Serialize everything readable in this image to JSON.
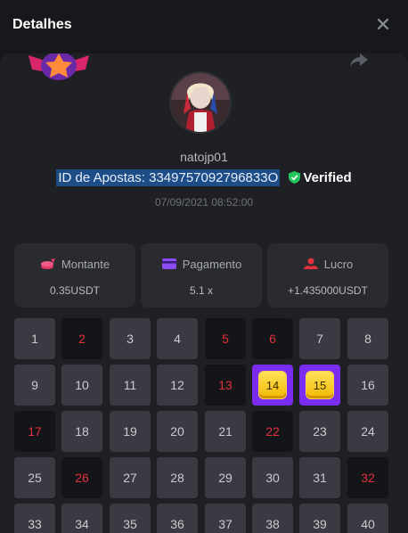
{
  "header": {
    "title": "Detalhes",
    "close_label": "✕"
  },
  "player": {
    "username": "natojp01",
    "bet_id_label": "ID de Apostas: 3349757092796833O",
    "verified_label": "Verified",
    "timestamp": "07/09/2021 08:52:00"
  },
  "stats": [
    {
      "label": "Montante",
      "value": "0.35USDT",
      "icon": "coins-icon",
      "color": "#e23a6a"
    },
    {
      "label": "Pagamento",
      "value": "5.1 x",
      "icon": "card-icon",
      "color": "#8a4bf0"
    },
    {
      "label": "Lucro",
      "value": "+1.435000USDT",
      "icon": "profit-icon",
      "color": "#e0323a"
    }
  ],
  "grid": [
    {
      "n": "1",
      "state": "normal"
    },
    {
      "n": "2",
      "state": "red"
    },
    {
      "n": "3",
      "state": "normal"
    },
    {
      "n": "4",
      "state": "normal"
    },
    {
      "n": "5",
      "state": "red"
    },
    {
      "n": "6",
      "state": "red"
    },
    {
      "n": "7",
      "state": "normal"
    },
    {
      "n": "8",
      "state": "normal"
    },
    {
      "n": "9",
      "state": "normal"
    },
    {
      "n": "10",
      "state": "normal"
    },
    {
      "n": "11",
      "state": "normal"
    },
    {
      "n": "12",
      "state": "normal"
    },
    {
      "n": "13",
      "state": "red"
    },
    {
      "n": "14",
      "state": "hit"
    },
    {
      "n": "15",
      "state": "hit"
    },
    {
      "n": "16",
      "state": "normal"
    },
    {
      "n": "17",
      "state": "red"
    },
    {
      "n": "18",
      "state": "normal"
    },
    {
      "n": "19",
      "state": "normal"
    },
    {
      "n": "20",
      "state": "normal"
    },
    {
      "n": "21",
      "state": "normal"
    },
    {
      "n": "22",
      "state": "red"
    },
    {
      "n": "23",
      "state": "normal"
    },
    {
      "n": "24",
      "state": "normal"
    },
    {
      "n": "25",
      "state": "normal"
    },
    {
      "n": "26",
      "state": "red"
    },
    {
      "n": "27",
      "state": "normal"
    },
    {
      "n": "28",
      "state": "normal"
    },
    {
      "n": "29",
      "state": "normal"
    },
    {
      "n": "30",
      "state": "normal"
    },
    {
      "n": "31",
      "state": "normal"
    },
    {
      "n": "32",
      "state": "red"
    },
    {
      "n": "33",
      "state": "normal"
    },
    {
      "n": "34",
      "state": "normal"
    },
    {
      "n": "35",
      "state": "normal"
    },
    {
      "n": "36",
      "state": "normal"
    },
    {
      "n": "37",
      "state": "normal"
    },
    {
      "n": "38",
      "state": "normal"
    },
    {
      "n": "39",
      "state": "normal"
    },
    {
      "n": "40",
      "state": "normal"
    }
  ],
  "colors": {
    "accent": "#7a2cf2",
    "verified": "#22c55e",
    "miss": "#e0323a"
  }
}
